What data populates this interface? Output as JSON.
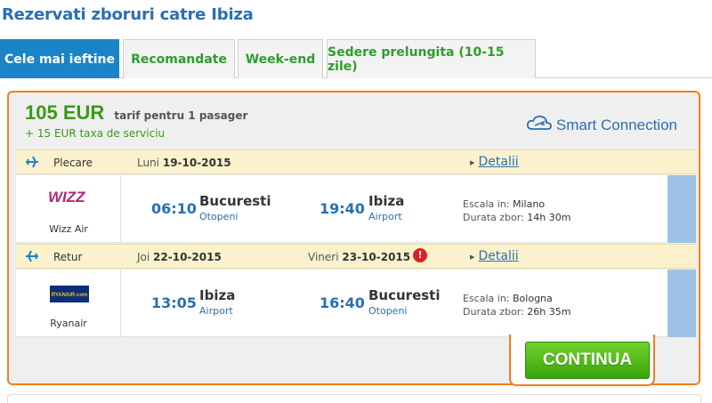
{
  "page": {
    "title": "Rezervati zboruri catre Ibiza"
  },
  "tabs": [
    {
      "label": "Cele mai ieftine",
      "active": true
    },
    {
      "label": "Recomandate",
      "active": false
    },
    {
      "label": "Week-end",
      "active": false
    },
    {
      "label": "Sedere prelungita (10-15 zile)",
      "active": false
    }
  ],
  "offer": {
    "price": "105 EUR",
    "price_note": "tarif pentru 1 pasager",
    "fee": "+ 15 EUR taxa de serviciu",
    "badge": "Smart Connection",
    "continue_label": "CONTINUA"
  },
  "segments": [
    {
      "direction": "Plecare",
      "day1": "Luni",
      "date1": "19-10-2015",
      "day2": "",
      "date2": "",
      "warning": false,
      "details_label": "Detalii",
      "airline": "Wizz Air",
      "airline_logo_text": "WIZZ",
      "dep_time": "06:10",
      "dep_city": "Bucuresti",
      "dep_airport": "Otopeni",
      "arr_time": "19:40",
      "arr_city": "Ibiza",
      "arr_airport": "Airport",
      "stop_label": "Escala in:",
      "stop_city": "Milano",
      "duration_label": "Durata zbor:",
      "duration": "14h 30m"
    },
    {
      "direction": "Retur",
      "day1": "Joi",
      "date1": "22-10-2015",
      "day2": "Vineri",
      "date2": "23-10-2015",
      "warning": true,
      "details_label": "Detalii",
      "airline": "Ryanair",
      "airline_logo_text": "RYANAIR.com",
      "dep_time": "13:05",
      "dep_city": "Ibiza",
      "dep_airport": "Airport",
      "arr_time": "16:40",
      "arr_city": "Bucuresti",
      "arr_airport": "Otopeni",
      "stop_label": "Escala in:",
      "stop_city": "Bologna",
      "duration_label": "Durata zbor:",
      "duration": "26h 35m"
    }
  ],
  "colors": {
    "accent_blue": "#1a84c9",
    "price_green": "#3a9a16",
    "card_border": "#f07f1d",
    "warning_red": "#e02020"
  }
}
